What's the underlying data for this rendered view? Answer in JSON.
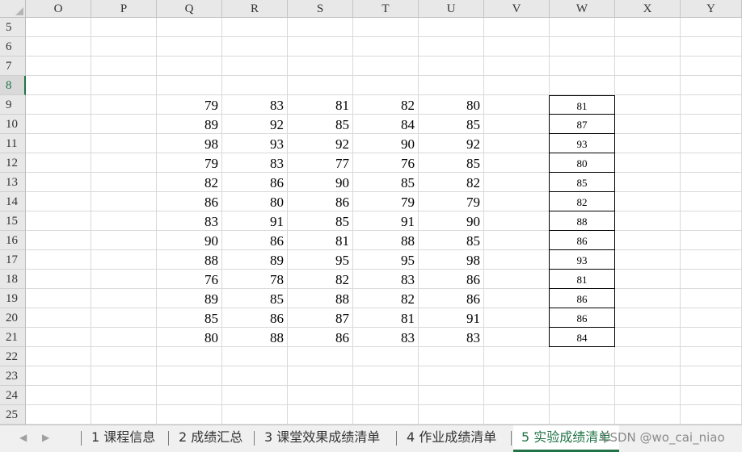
{
  "columns": [
    "O",
    "P",
    "Q",
    "R",
    "S",
    "T",
    "U",
    "V",
    "W",
    "X",
    "Y"
  ],
  "active_row": "8",
  "rows": [
    {
      "num": "5",
      "Q": "",
      "R": "",
      "S": "",
      "T": "",
      "U": "",
      "W": ""
    },
    {
      "num": "6",
      "Q": "",
      "R": "",
      "S": "",
      "T": "",
      "U": "",
      "W": ""
    },
    {
      "num": "7",
      "Q": "",
      "R": "",
      "S": "",
      "T": "",
      "U": "",
      "W": ""
    },
    {
      "num": "8",
      "Q": "",
      "R": "",
      "S": "",
      "T": "",
      "U": "",
      "W": ""
    },
    {
      "num": "9",
      "Q": "79",
      "R": "83",
      "S": "81",
      "T": "82",
      "U": "80",
      "W": "81"
    },
    {
      "num": "10",
      "Q": "89",
      "R": "92",
      "S": "85",
      "T": "84",
      "U": "85",
      "W": "87"
    },
    {
      "num": "11",
      "Q": "98",
      "R": "93",
      "S": "92",
      "T": "90",
      "U": "92",
      "W": "93"
    },
    {
      "num": "12",
      "Q": "79",
      "R": "83",
      "S": "77",
      "T": "76",
      "U": "85",
      "W": "80"
    },
    {
      "num": "13",
      "Q": "82",
      "R": "86",
      "S": "90",
      "T": "85",
      "U": "82",
      "W": "85"
    },
    {
      "num": "14",
      "Q": "86",
      "R": "80",
      "S": "86",
      "T": "79",
      "U": "79",
      "W": "82"
    },
    {
      "num": "15",
      "Q": "83",
      "R": "91",
      "S": "85",
      "T": "91",
      "U": "90",
      "W": "88"
    },
    {
      "num": "16",
      "Q": "90",
      "R": "86",
      "S": "81",
      "T": "88",
      "U": "85",
      "W": "86"
    },
    {
      "num": "17",
      "Q": "88",
      "R": "89",
      "S": "95",
      "T": "95",
      "U": "98",
      "W": "93"
    },
    {
      "num": "18",
      "Q": "76",
      "R": "78",
      "S": "82",
      "T": "83",
      "U": "86",
      "W": "81"
    },
    {
      "num": "19",
      "Q": "89",
      "R": "85",
      "S": "88",
      "T": "82",
      "U": "86",
      "W": "86"
    },
    {
      "num": "20",
      "Q": "85",
      "R": "86",
      "S": "87",
      "T": "81",
      "U": "91",
      "W": "86"
    },
    {
      "num": "21",
      "Q": "80",
      "R": "88",
      "S": "86",
      "T": "83",
      "U": "83",
      "W": "84"
    },
    {
      "num": "22",
      "Q": "",
      "R": "",
      "S": "",
      "T": "",
      "U": "",
      "W": ""
    },
    {
      "num": "23",
      "Q": "",
      "R": "",
      "S": "",
      "T": "",
      "U": "",
      "W": ""
    },
    {
      "num": "24",
      "Q": "",
      "R": "",
      "S": "",
      "T": "",
      "U": "",
      "W": ""
    },
    {
      "num": "25",
      "Q": "",
      "R": "",
      "S": "",
      "T": "",
      "U": "",
      "W": ""
    }
  ],
  "tabs": [
    {
      "label": "1 课程信息",
      "active": false
    },
    {
      "label": "2 成绩汇总",
      "active": false
    },
    {
      "label": "3 课堂效果成绩清单",
      "active": false
    },
    {
      "label": "4 作业成绩清单",
      "active": false
    },
    {
      "label": "5 实验成绩清单",
      "active": true
    }
  ],
  "nav": {
    "prev_icon": "chevron-left-icon",
    "next_icon": "chevron-right-icon"
  },
  "watermark": "CSDN @wo_cai_niao",
  "colors": {
    "accent": "#217346",
    "header_bg": "#e8e8e8",
    "grid": "#d9d9d9"
  }
}
